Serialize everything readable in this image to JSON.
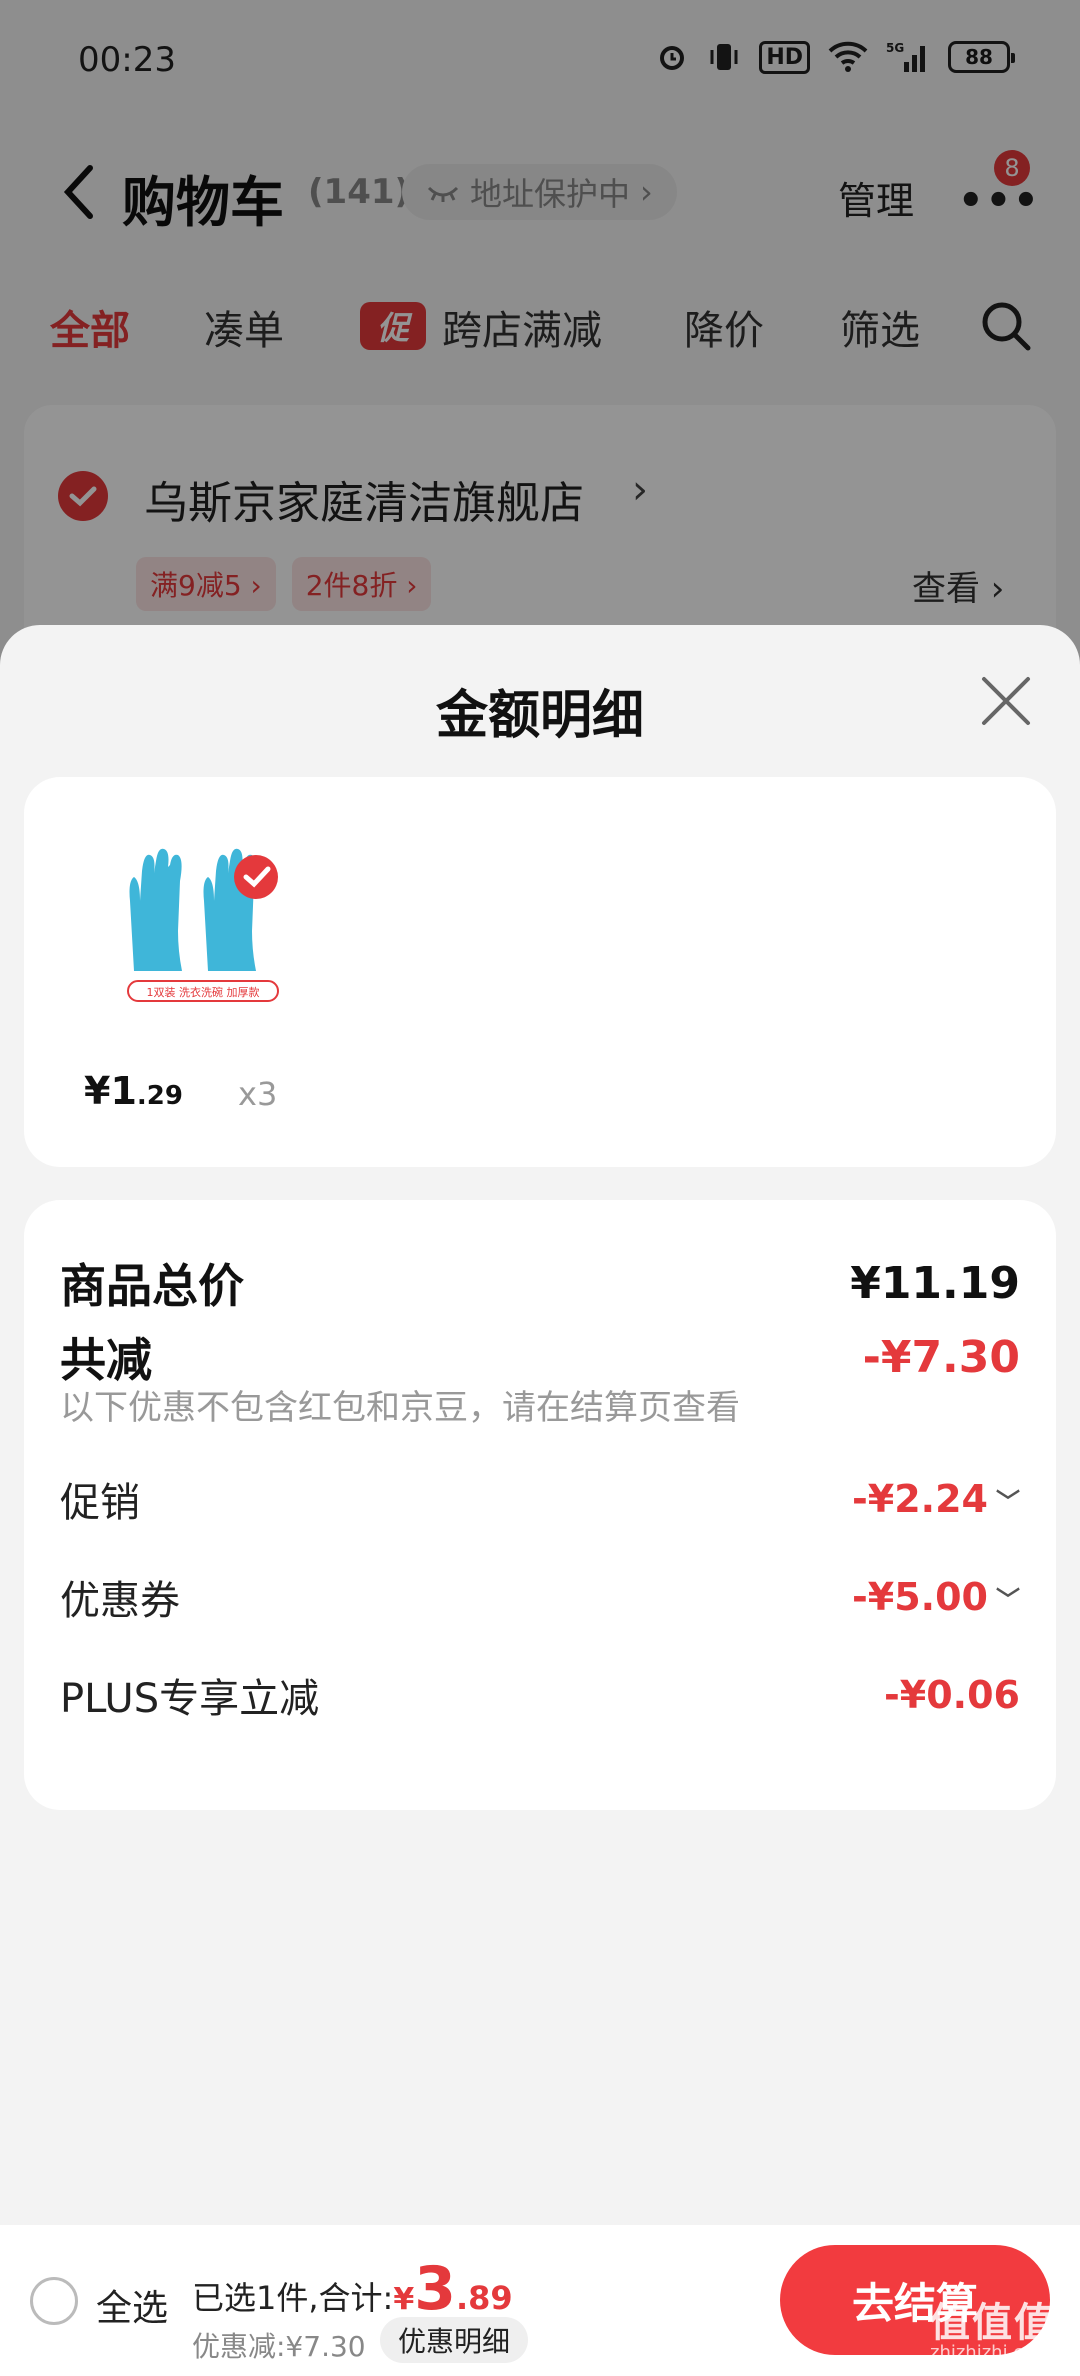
{
  "status_bar": {
    "time": "00:23",
    "network": "5G",
    "hd": "HD",
    "battery": "88"
  },
  "nav": {
    "title": "购物车",
    "count": "(141)",
    "address_protect": "地址保护中",
    "manage": "管理",
    "more_badge": "8"
  },
  "tabs": [
    {
      "label": "全部",
      "active": true
    },
    {
      "label": "凑单"
    },
    {
      "label": "促",
      "promo": true
    },
    {
      "label": "跨店满减"
    },
    {
      "label": "降价"
    },
    {
      "label": "筛选"
    }
  ],
  "store": {
    "name": "乌斯京家庭清洁旗舰店",
    "tags": [
      "满9减5 ›",
      "2件8折 ›"
    ],
    "view": "查看 ›"
  },
  "sheet": {
    "title": "金额明细",
    "product": {
      "price_main": "¥1",
      "price_decimal": ".29",
      "quantity": "x3",
      "image_caption": "1双装 洗衣洗碗 加厚款"
    },
    "details": {
      "total_label": "商品总价",
      "total_value": "¥11.19",
      "discount_label": "共减",
      "discount_value": "-¥7.30",
      "discount_note": "以下优惠不包含红包和京豆，请在结算页查看",
      "items": [
        {
          "label": "促销",
          "value": "-¥2.24",
          "expandable": true
        },
        {
          "label": "优惠券",
          "value": "-¥5.00",
          "expandable": true
        },
        {
          "label": "PLUS专享立减",
          "value": "-¥0.06",
          "expandable": false
        }
      ]
    }
  },
  "bottom_bar": {
    "select_all": "全选",
    "summary_prefix": "已选1件,合计:",
    "currency": "¥",
    "total_int": "3",
    "total_dec": ".89",
    "discount_text": "优惠减:¥7.30",
    "discount_detail": "优惠明细",
    "checkout": "去结算"
  },
  "watermark": {
    "text": "值值值",
    "sub": "zhizhizhi.com"
  },
  "colors": {
    "accent_red": "#e4393c",
    "checkout_red": "#f23b3f",
    "glove_blue": "#3fb6d9"
  }
}
